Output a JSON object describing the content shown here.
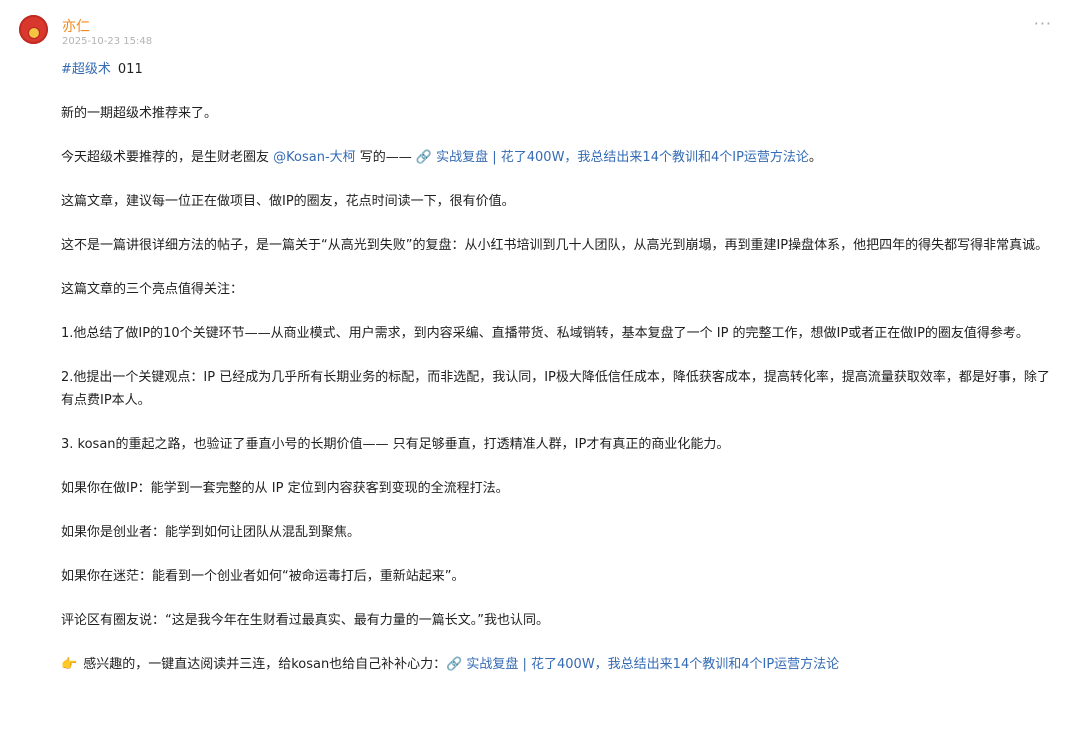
{
  "post": {
    "author": "亦仁",
    "timestamp": "2025-10-23 15:48",
    "more_icon": "ellipsis-icon"
  },
  "tag": {
    "hashtag": "#超级术",
    "issue": "011"
  },
  "paragraphs": {
    "p1": "新的一期超级术推荐来了。",
    "p2_prefix": "今天超级术要推荐的，是生财老圈友 ",
    "p2_mention": "@Kosan-大柯",
    "p2_mid": " 写的—— ",
    "p2_link": "实战复盘 | 花了400W，我总结出来14个教训和4个IP运营方法论",
    "p2_suffix": "。",
    "p3": "这篇文章，建议每一位正在做项目、做IP的圈友，花点时间读一下，很有价值。",
    "p4": "这不是一篇讲很详细方法的帖子，是一篇关于“从高光到失败”的复盘：从小红书培训到几十人团队，从高光到崩塌，再到重建IP操盘体系，他把四年的得失都写得非常真诚。",
    "p5": "这篇文章的三个亮点值得关注：",
    "p6": "1.他总结了做IP的10个关键环节——从商业模式、用户需求，到内容采编、直播带货、私域销转，基本复盘了一个 IP 的完整工作，想做IP或者正在做IP的圈友值得参考。",
    "p7": "2.他提出一个关键观点：IP 已经成为几乎所有长期业务的标配，而非选配，我认同，IP极大降低信任成本，降低获客成本，提高转化率，提高流量获取效率，都是好事，除了有点费IP本人。",
    "p8": "3. kosan的重起之路，也验证了垂直小号的长期价值—— 只有足够垂直，打透精准人群，IP才有真正的商业化能力。",
    "p9": "如果你在做IP：能学到一套完整的从 IP 定位到内容获客到变现的全流程打法。",
    "p10": "如果你是创业者：能学到如何让团队从混乱到聚焦。",
    "p11": "如果你在迷茫：能看到一个创业者如何“被命运毒打后，重新站起来”。",
    "p12": "评论区有圈友说：“这是我今年在生财看过最真实、最有力量的一篇长文。”我也认同。",
    "p13_prefix": "感兴趣的，一键直达阅读并三连，给kosan也给自己补补心力：",
    "p13_link": "实战复盘 | 花了400W，我总结出来14个教训和4个IP运营方法论"
  },
  "icons": {
    "link": "🔗",
    "hand": "👉"
  },
  "colors": {
    "author": "#f08a1c",
    "link": "#356bb4",
    "avatar": "#d8382e"
  }
}
